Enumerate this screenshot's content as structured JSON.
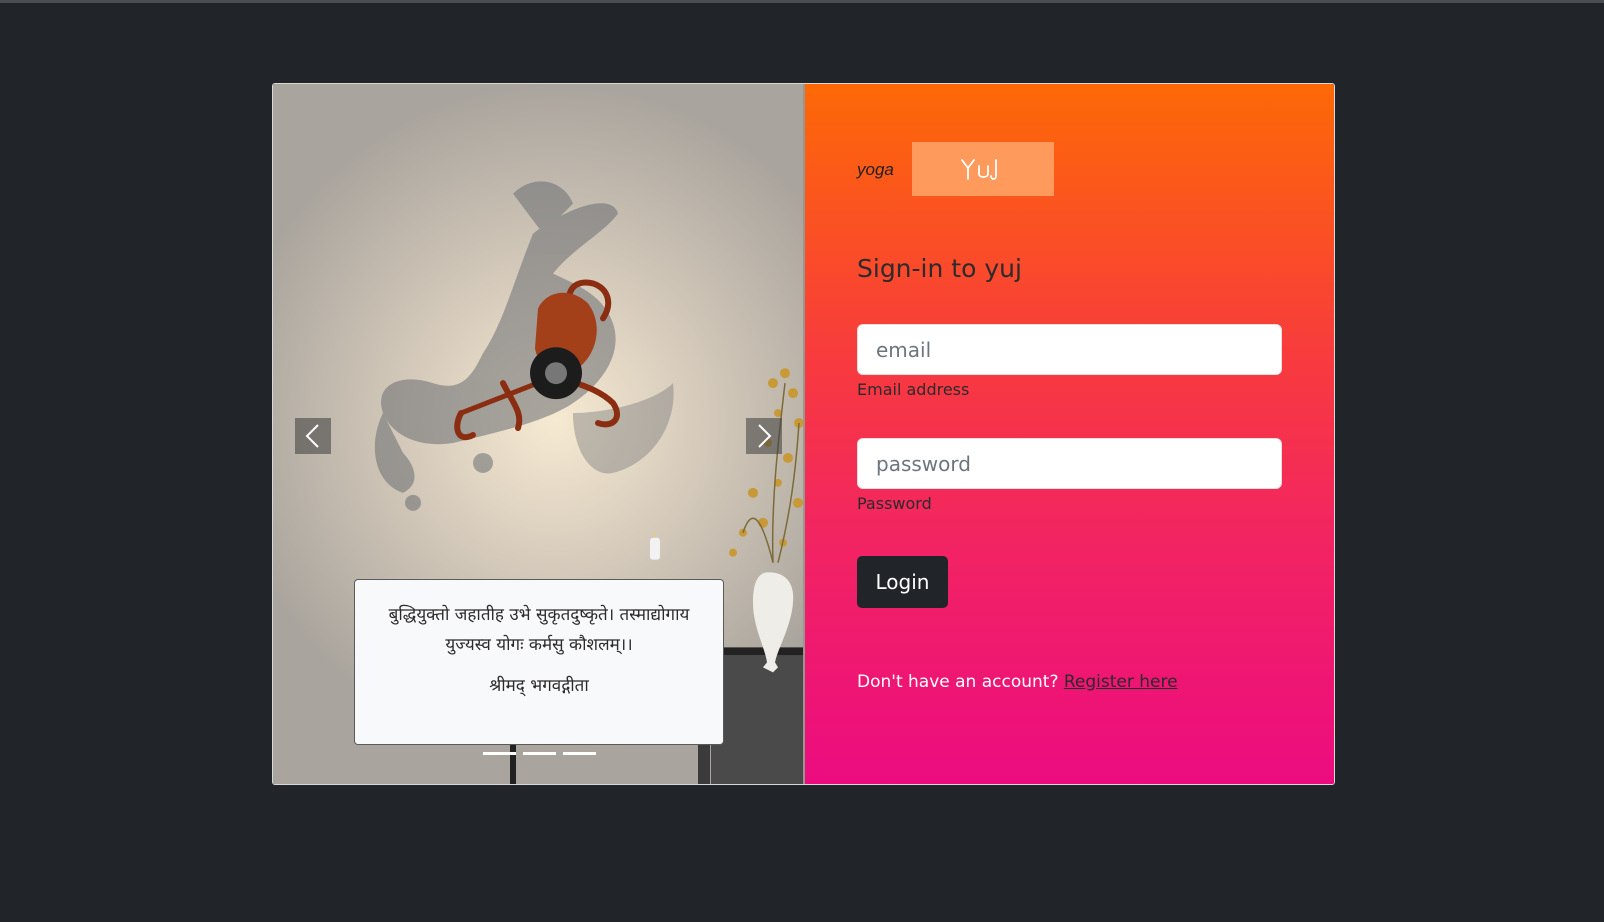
{
  "carousel": {
    "caption_verse": "बुद्धियुक्तो जहातीह उभे सुकृतदुष्कृते। तस्माद्योगाय युज्यस्व योगः कर्मसु कौशलम्।।",
    "caption_source": "श्रीमद् भगवद्गीता",
    "slide_count": 3,
    "active_index": 0
  },
  "brand": {
    "text": "yoga",
    "logo_alt": "Yuj"
  },
  "signin": {
    "heading": "Sign-in to yuj",
    "email_placeholder": "email",
    "email_label": "Email address",
    "password_placeholder": "password",
    "password_label": "Password",
    "login_label": "Login",
    "register_prompt": "Don't have an account?",
    "register_link": "Register here"
  },
  "colors": {
    "page_background": "#212529",
    "gradient_top": "#fd6906",
    "gradient_bottom": "#ec0c80",
    "logo_box": "#fd9a5c",
    "button": "#212529"
  }
}
